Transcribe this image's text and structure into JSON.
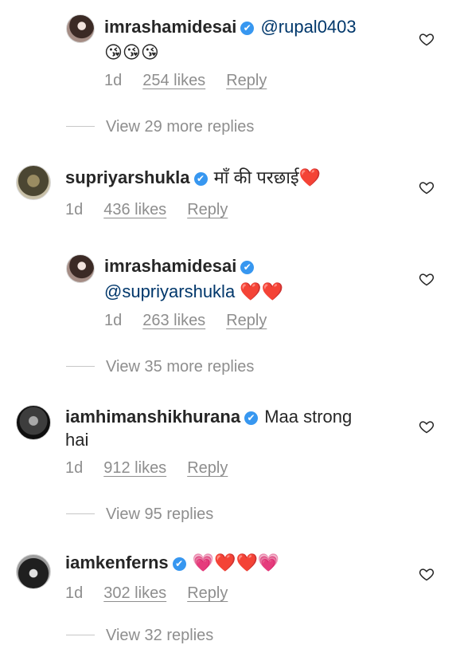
{
  "comments": [
    {
      "username": "imrashamidesai",
      "text": "@rupal0403",
      "emoji_line": "😘😘😘",
      "age": "1d",
      "likes": "254 likes",
      "reply": "Reply",
      "view_replies": "View 29 more replies"
    },
    {
      "username": "supriyarshukla",
      "text": "माँ की परछाई❤️",
      "age": "1d",
      "likes": "436 likes",
      "reply": "Reply"
    },
    {
      "username": "imrashamidesai",
      "text": "@supriyarshukla",
      "emoji_tail": "❤️❤️",
      "age": "1d",
      "likes": "263 likes",
      "reply": "Reply",
      "view_replies": "View 35 more replies"
    },
    {
      "username": "iamhimanshikhurana",
      "text_line1": "Maa strong",
      "text_line2": "hai",
      "age": "1d",
      "likes": "912 likes",
      "reply": "Reply",
      "view_replies": "View 95 replies"
    },
    {
      "username": "iamkenferns",
      "text": "💗❤️❤️💗",
      "age": "1d",
      "likes": "302 likes",
      "reply": "Reply",
      "view_replies": "View 32 replies"
    }
  ],
  "verified_glyph": "✔",
  "icons": {
    "like": "heart-outline-icon",
    "verified": "verified-badge-icon"
  },
  "colors": {
    "verified": "#3797f0",
    "mention": "#00376b",
    "meta": "#8e8e8e"
  }
}
